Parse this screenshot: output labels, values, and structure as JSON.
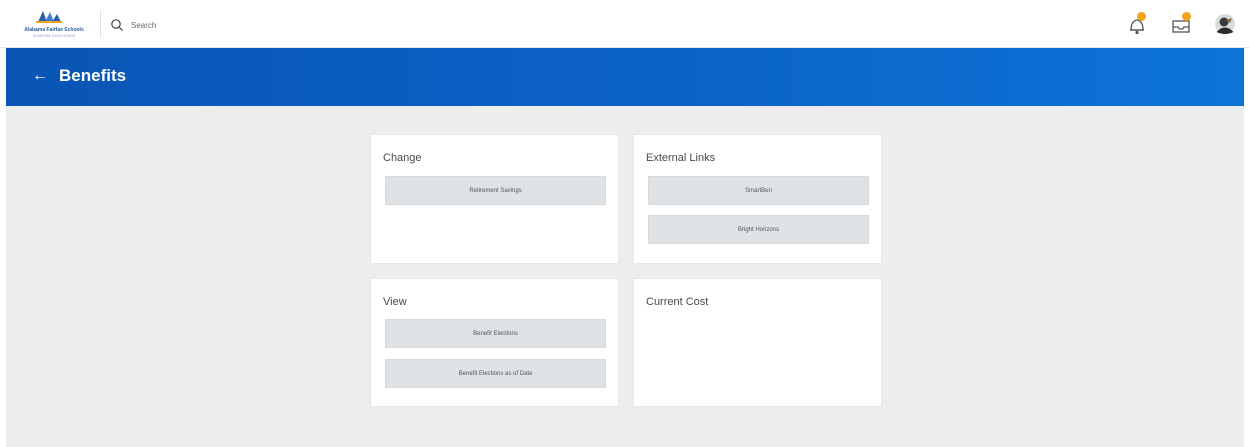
{
  "topbar": {
    "logo": {
      "name": "Alabama Fairfax Schools",
      "subtitle": "ACADEMIC EXCELLENCE"
    },
    "search": {
      "placeholder": "Search"
    },
    "icons": [
      "notifications-icon",
      "inbox-icon",
      "profile-avatar"
    ]
  },
  "header": {
    "back_icon": "←",
    "title": "Benefits"
  },
  "cards": {
    "change": {
      "title": "Change",
      "buttons": [
        "Retirement Savings"
      ]
    },
    "external_links": {
      "title": "External Links",
      "buttons": [
        "SmartBen",
        "Bright Horizons"
      ]
    },
    "view": {
      "title": "View",
      "buttons": [
        "Benefit Elections",
        "Benefit Elections as of Date"
      ]
    },
    "current_cost": {
      "title": "Current Cost"
    }
  },
  "colors": {
    "header_blue": "#0b63c8",
    "badge_orange": "#f0a420",
    "content_bg": "#ededee",
    "button_gray": "#dfe3e6"
  }
}
